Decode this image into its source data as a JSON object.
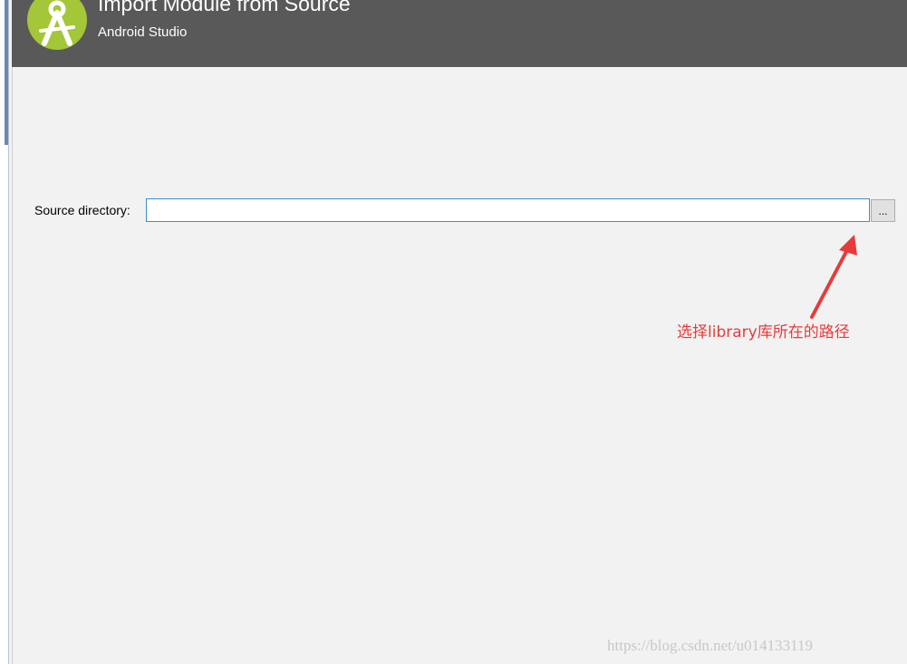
{
  "header": {
    "title": "Import Module from Source",
    "subtitle": "Android Studio",
    "logo_icon": "android-studio-icon"
  },
  "form": {
    "source_label": "Source directory:",
    "source_value": "",
    "browse_label": "..."
  },
  "annotation": {
    "text": "选择library库所在的路径",
    "color": "#e83a3a"
  },
  "watermark": "https://blog.csdn.net/u014133119",
  "colors": {
    "header_bg": "#595959",
    "content_bg": "#f2f2f2",
    "logo_green": "#a4c639",
    "input_border": "#3c8fd1"
  }
}
